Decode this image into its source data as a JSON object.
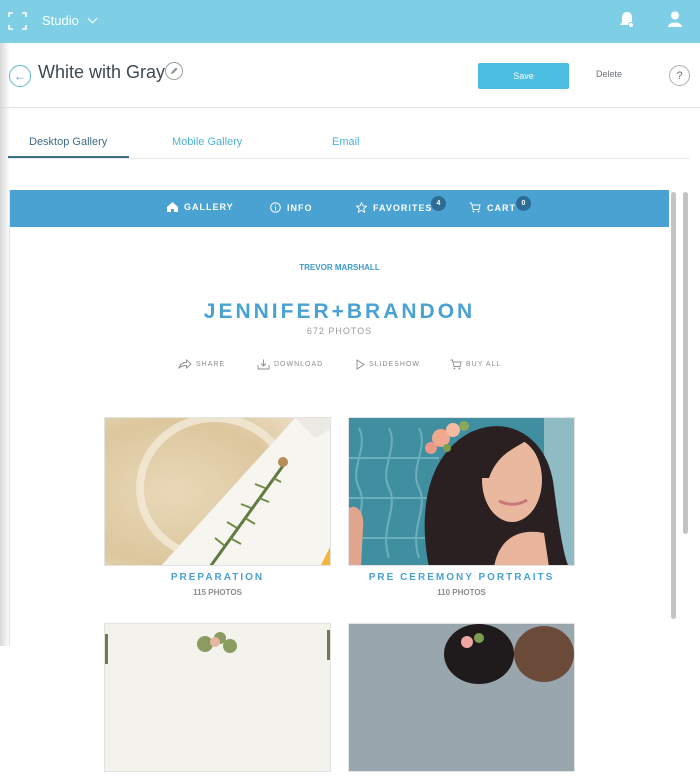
{
  "topbar": {
    "app_menu_label": "Studio",
    "icons": [
      "frame-icon",
      "chevron-down-icon",
      "bell-icon",
      "user-icon"
    ]
  },
  "header": {
    "title": "White with Gray",
    "save_label": "Save",
    "delete_label": "Delete",
    "help_label": "?"
  },
  "tabs": [
    {
      "label": "Desktop Gallery",
      "active": true
    },
    {
      "label": "Mobile Gallery",
      "active": false
    },
    {
      "label": "Email",
      "active": false
    }
  ],
  "gallery": {
    "nav": [
      {
        "label": "GALLERY",
        "icon": "home-icon"
      },
      {
        "label": "INFO",
        "icon": "info-icon"
      },
      {
        "label": "FAVORITES",
        "icon": "star-icon",
        "badge": "4"
      },
      {
        "label": "CART",
        "icon": "cart-icon",
        "badge": "0"
      }
    ],
    "photographer": "TREVOR MARSHALL",
    "title": "JENNIFER+BRANDON",
    "photo_count": "672 PHOTOS",
    "actions": [
      {
        "label": "SHARE",
        "icon": "share-icon"
      },
      {
        "label": "DOWNLOAD",
        "icon": "download-icon"
      },
      {
        "label": "SLIDESHOW",
        "icon": "play-icon"
      },
      {
        "label": "BUY ALL",
        "icon": "cart-icon"
      }
    ],
    "albums": [
      {
        "name": "PREPARATION",
        "count": "115 PHOTOS"
      },
      {
        "name": "PRE CEREMONY PORTRAITS",
        "count": "110 PHOTOS"
      },
      {
        "name": "",
        "count": ""
      },
      {
        "name": "",
        "count": ""
      }
    ]
  },
  "colors": {
    "topbar": "#7ecfe6",
    "accent": "#4aa2d2",
    "save_button": "#4bbde0",
    "active_tab": "#3f6e85"
  }
}
